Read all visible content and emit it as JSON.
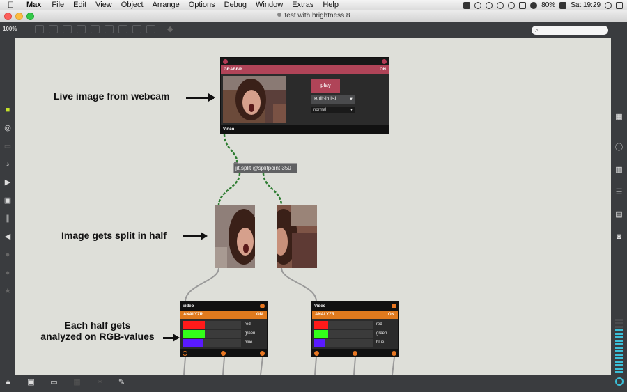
{
  "menubar": {
    "apple": "",
    "app_name": "Max",
    "menus": [
      "File",
      "Edit",
      "View",
      "Object",
      "Arrange",
      "Options",
      "Debug",
      "Window",
      "Extras",
      "Help"
    ],
    "battery": "80%",
    "clock": "Sat 19:29"
  },
  "window": {
    "title": "test with brightness 8",
    "zoom": "100%"
  },
  "annotations": {
    "live_image": "Live image from webcam",
    "split": "Image gets split in half",
    "analyzed_line1": "Each half gets",
    "analyzed_line2": "analyzed on RGB-values"
  },
  "grabber": {
    "name": "GRABBR",
    "state": "ON",
    "play_label": "play",
    "device": "Built-in iSi...",
    "mode": "normal",
    "output_label": "Video"
  },
  "split_object": {
    "text": "jit.split @splitpoint 350"
  },
  "analyzers": [
    {
      "input_label": "Video",
      "name": "ANALYZR",
      "state": "ON",
      "channels": [
        {
          "label": "red",
          "level": 0.38,
          "color": "#ff1a1a"
        },
        {
          "label": "green",
          "level": 0.38,
          "color": "#33ff1a"
        },
        {
          "label": "blue",
          "level": 0.34,
          "color": "#5a1aff"
        }
      ]
    },
    {
      "input_label": "Video",
      "name": "ANALYZR",
      "state": "ON",
      "channels": [
        {
          "label": "red",
          "level": 0.24,
          "color": "#ff1a1a"
        },
        {
          "label": "green",
          "level": 0.24,
          "color": "#33ff1a"
        },
        {
          "label": "blue",
          "level": 0.19,
          "color": "#5a1aff"
        }
      ]
    }
  ],
  "colors": {
    "grabber_accent": "#b04458",
    "analyzer_accent": "#e07a1e",
    "cable_video": "#2e7d32",
    "canvas": "#dedfd9"
  },
  "icons": {
    "left_sidebar": [
      "cube-icon",
      "target-icon",
      "film-icon",
      "note-icon",
      "play-step-icon",
      "image-icon",
      "clip-icon",
      "plug-icon",
      "circle-icon",
      "moon-icon",
      "star-icon"
    ],
    "right_sidebar": [
      "grid-icon",
      "info-icon",
      "book-icon",
      "list-icon",
      "reference-icon",
      "camera-icon"
    ],
    "bottom_bar": [
      "lock-icon",
      "presentation-icon",
      "screen-icon",
      "grid-icon",
      "wand-icon",
      "wrench-icon"
    ]
  }
}
